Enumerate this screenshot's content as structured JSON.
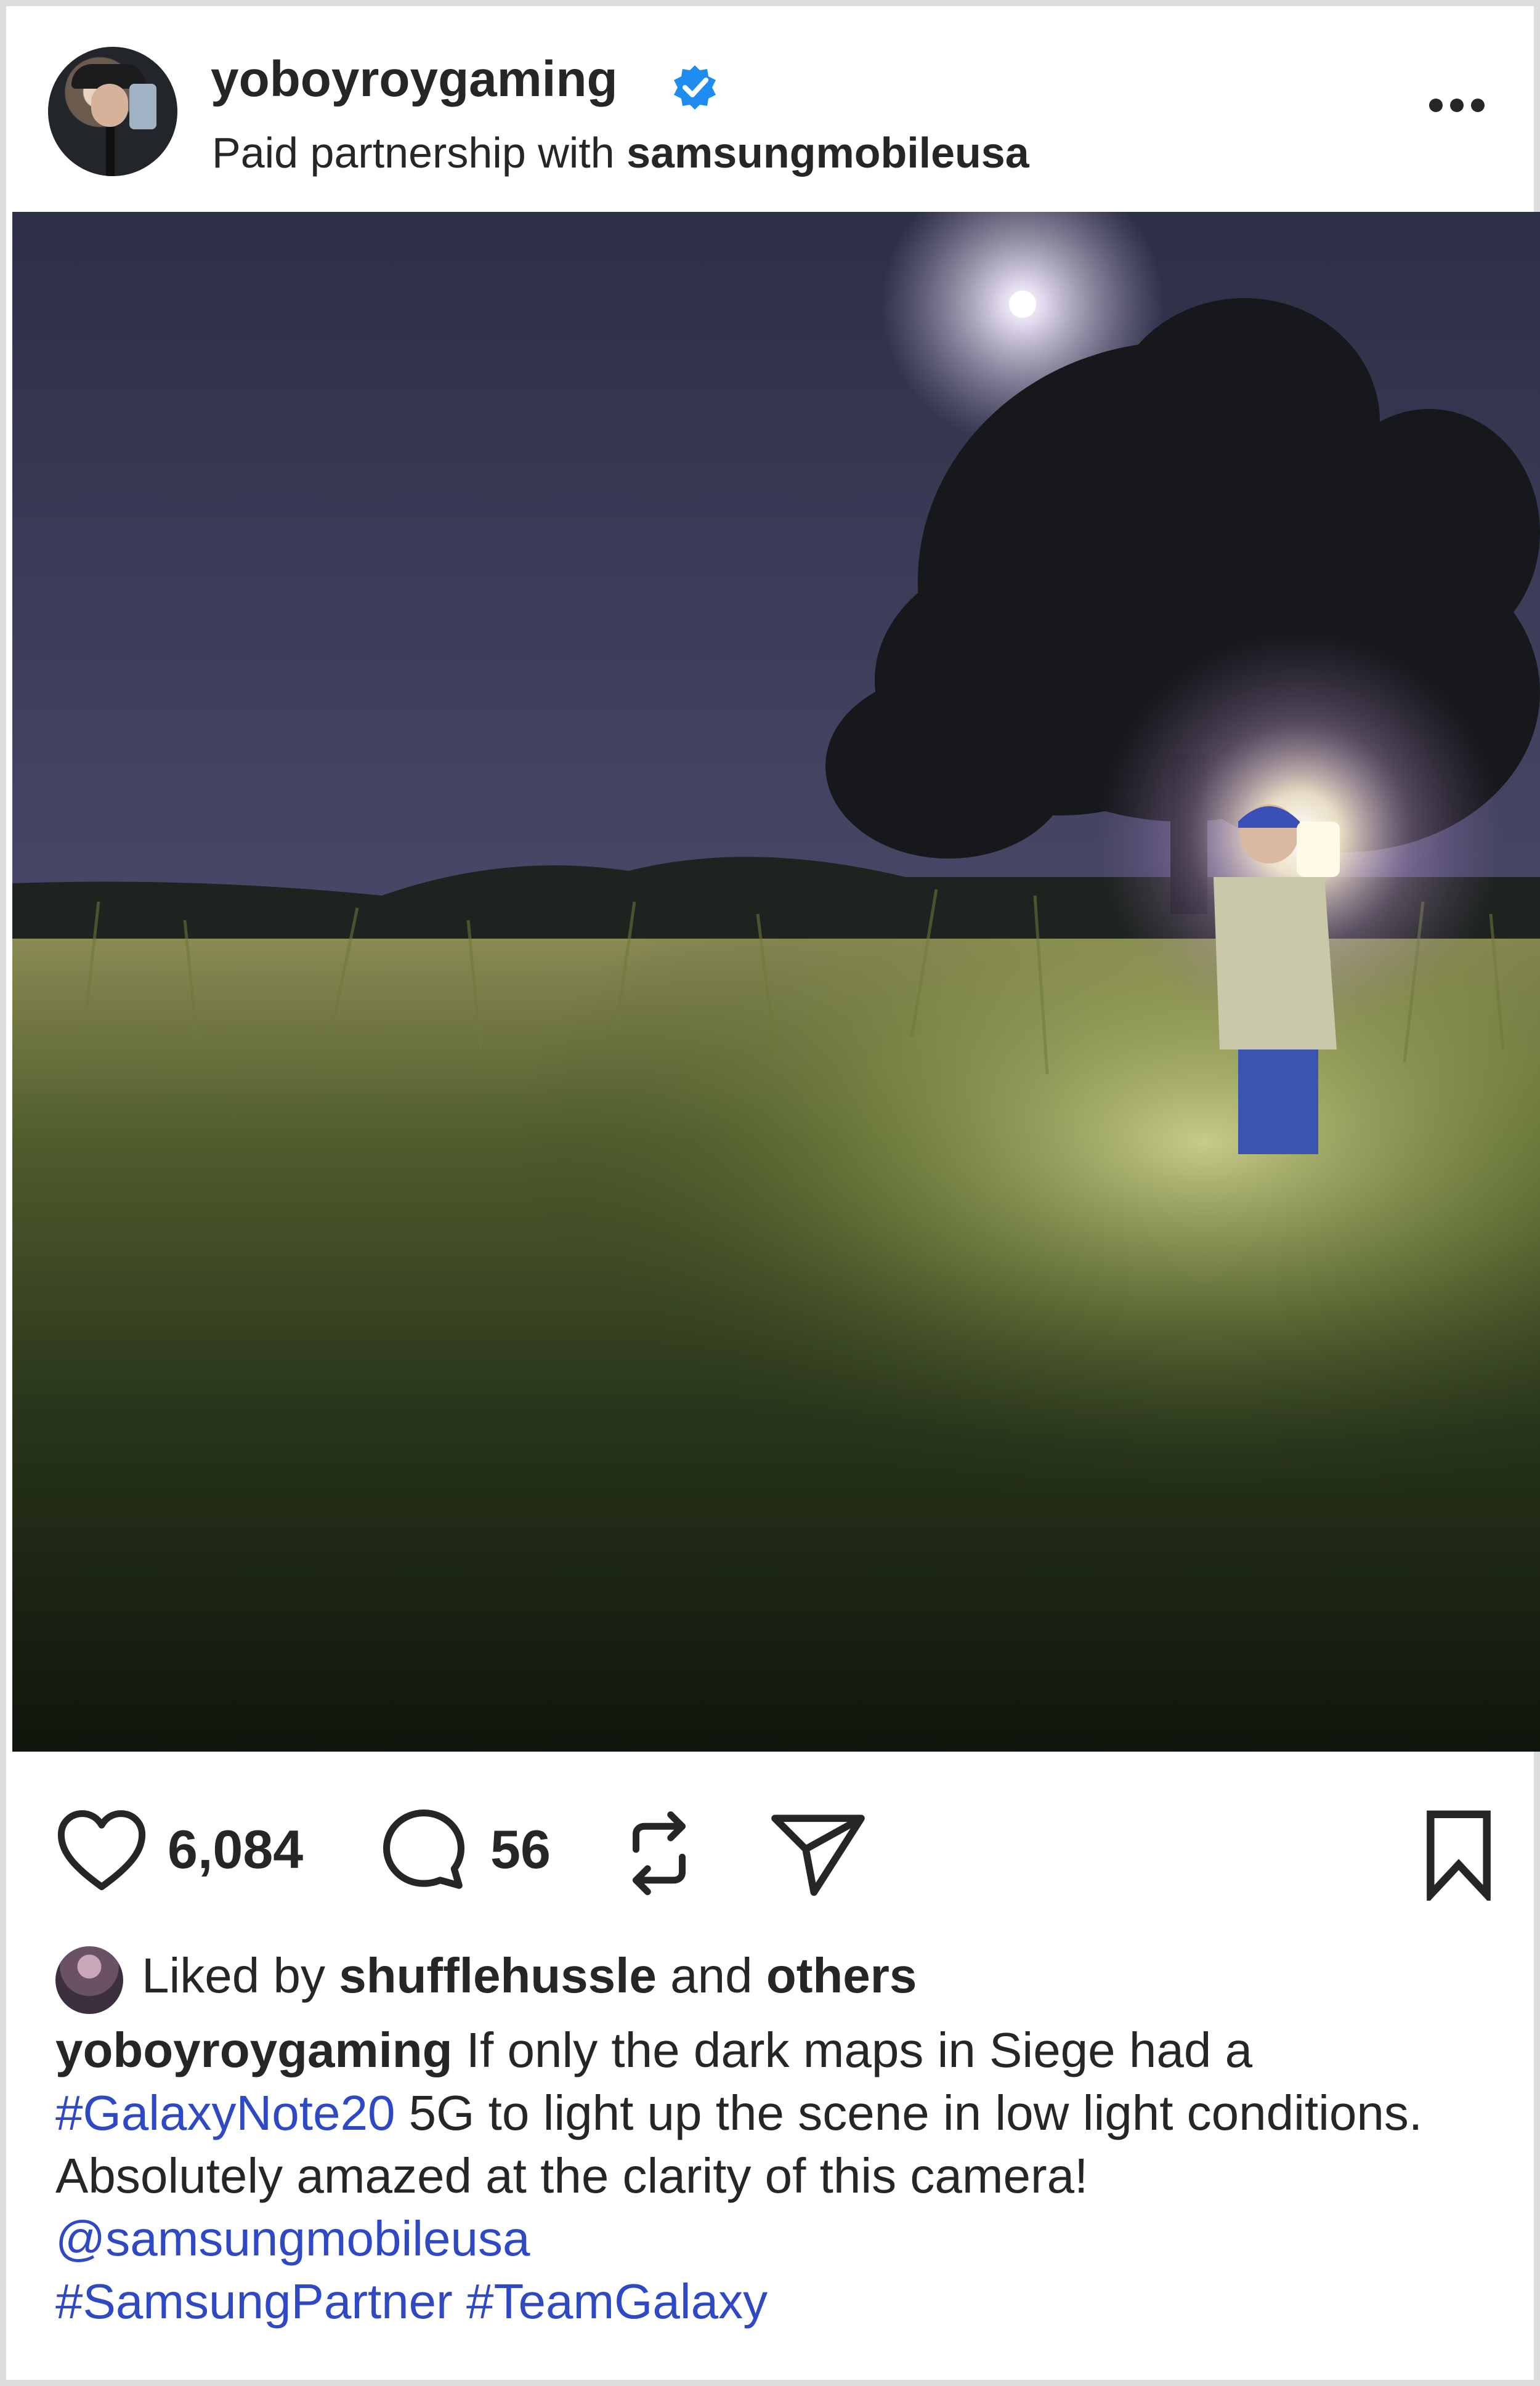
{
  "post": {
    "username": "yoboyroygaming",
    "verified_icon": "verified-badge-icon",
    "partnership_prefix": "Paid partnership with",
    "partner": "samsungmobileusa",
    "more_icon": "more-options-icon"
  },
  "photo": {
    "colors": {
      "sky_top": "#2f3248",
      "sky_bottom": "#7a6c8e",
      "grass": "#4a5a2a",
      "ground_dark": "#141a10",
      "lantern": "#fff6d8"
    }
  },
  "actions": {
    "like_count": "6,084",
    "comment_count": "56",
    "icons": [
      "heart-icon",
      "comment-icon",
      "repost-icon",
      "share-icon",
      "bookmark-icon"
    ]
  },
  "likes": {
    "prefix": "Liked by",
    "user": "shufflehussle",
    "middle": "and",
    "others": "others"
  },
  "caption": {
    "author": "yoboyroygaming",
    "text_1": " If only the dark maps in Siege had a ",
    "tag_1": "#GalaxyNote20",
    "text_2": " 5G to light up the scene in low light conditions. Absolutely amazed at the clarity of this camera! ",
    "mention": "@samsungmobileusa",
    "tag_2": "#SamsungPartner",
    "tag_3": "#TeamGalaxy"
  },
  "colors": {
    "link": "#2f49c4",
    "verified": "#1f8cf0",
    "text": "#262626"
  }
}
